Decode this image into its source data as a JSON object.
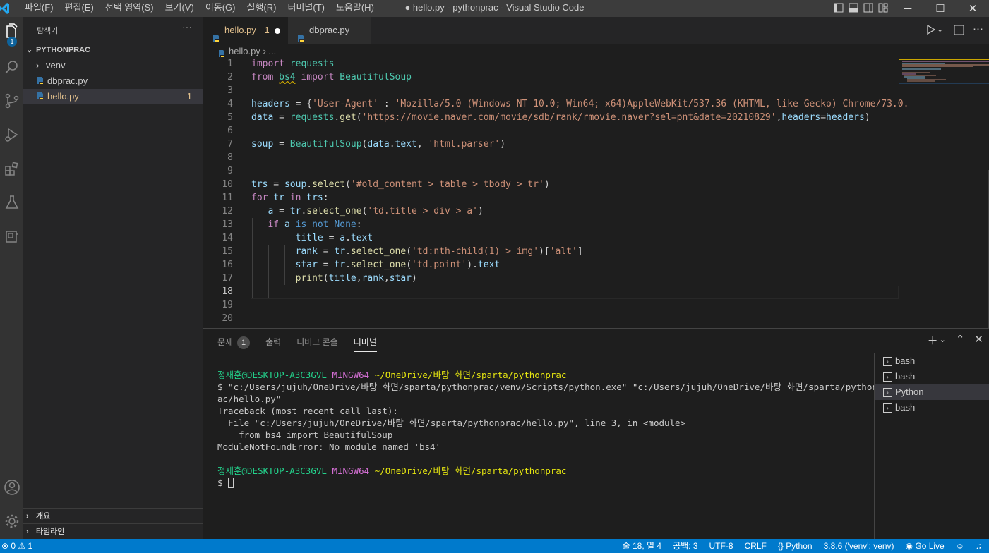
{
  "window": {
    "title": "● hello.py - pythonprac - Visual Studio Code",
    "menus": [
      "파일(F)",
      "편집(E)",
      "선택 영역(S)",
      "보기(V)",
      "이동(G)",
      "실행(R)",
      "터미널(T)",
      "도움말(H)"
    ]
  },
  "activity_bar": {
    "explorer_badge": "1"
  },
  "sidebar": {
    "title": "탐색기",
    "more": "···",
    "project": "PYTHONPRAC",
    "items": [
      {
        "label": "venv",
        "type": "folder"
      },
      {
        "label": "dbprac.py",
        "type": "python"
      },
      {
        "label": "hello.py",
        "type": "python",
        "problems": "1",
        "selected": true
      }
    ],
    "outline_label": "개요",
    "timeline_label": "타임라인"
  },
  "editor": {
    "tabs": [
      {
        "label": "hello.py",
        "badge": "1",
        "modified": true,
        "active": true
      },
      {
        "label": "dbprac.py",
        "active": false
      }
    ],
    "breadcrumb": "hello.py",
    "breadcrumb_more": "...",
    "current_line": 18
  },
  "panel": {
    "tabs": [
      {
        "label": "문제",
        "count": "1"
      },
      {
        "label": "출력"
      },
      {
        "label": "디버그 콘솔"
      },
      {
        "label": "터미널",
        "active": true
      }
    ],
    "terminals": [
      {
        "label": "bash"
      },
      {
        "label": "bash"
      },
      {
        "label": "Python",
        "active": true
      },
      {
        "label": "bash"
      }
    ],
    "prompt_user": "정재훈@DESKTOP-A3C3GVL",
    "prompt_env": "MINGW64",
    "prompt_path": "~/OneDrive/바탕 화면/sparta/pythonprac",
    "command_line_1": "$ \"c:/Users/jujuh/OneDrive/바탕 화면/sparta/pythonprac/venv/Scripts/python.exe\" \"c:/Users/jujuh/OneDrive/바탕 화면/sparta/pythonpr",
    "command_line_2": "ac/hello.py\"",
    "traceback": "Traceback (most recent call last):",
    "file_line": "  File \"c:/Users/jujuh/OneDrive/바탕 화면/sparta/pythonprac/hello.py\", line 3, in <module>",
    "code_line": "    from bs4 import BeautifulSoup",
    "error": "ModuleNotFoundError: No module named 'bs4'",
    "prompt_symbol": "$"
  },
  "status_bar": {
    "errors": "0",
    "warnings": "1",
    "position": "줄 18, 열 4",
    "indent": "공백: 3",
    "encoding": "UTF-8",
    "eol": "CRLF",
    "language": "Python",
    "interpreter": "3.8.6 ('venv': venv)",
    "golive": "Go Live"
  },
  "colors": {
    "accent": "#007acc",
    "modified_tab": "#e2c08d"
  }
}
